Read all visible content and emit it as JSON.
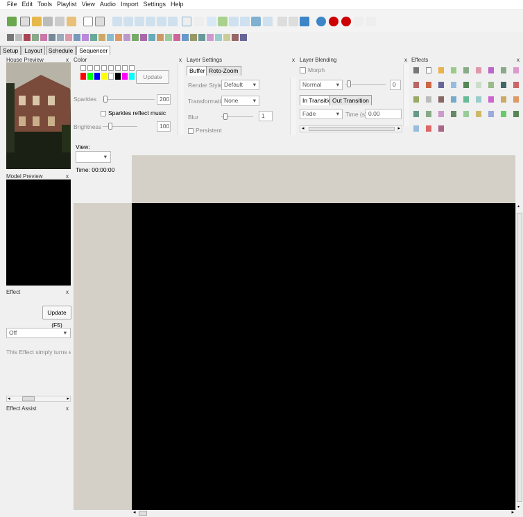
{
  "menu": [
    "File",
    "Edit",
    "Tools",
    "Playlist",
    "View",
    "Audio",
    "Import",
    "Settings",
    "Help"
  ],
  "tabs": [
    "Setup",
    "Layout",
    "Schedule",
    "Sequencer"
  ],
  "active_tab": "Sequencer",
  "panels": {
    "house_preview": {
      "title": "House Preview",
      "close": "x"
    },
    "model_preview": {
      "title": "Model Preview",
      "close": "x"
    },
    "effect": {
      "title": "Effect",
      "close": "x",
      "update_label": "Update (F5)",
      "selected": "Off",
      "description": "This Effect simply turns ever"
    },
    "effect_assist": {
      "title": "Effect Assist",
      "close": "x"
    },
    "color": {
      "title": "Color",
      "close": "x",
      "update_label": "Update",
      "sparkles_label": "Sparkles",
      "sparkles_value": "200",
      "sparkles_reflect_label": "Sparkles reflect music",
      "brightness_label": "Brightness",
      "brightness_value": "100"
    },
    "layer_settings": {
      "title": "Layer Settings",
      "close": "x",
      "tab_buffer": "Buffer",
      "tab_rotozoom": "Roto-Zoom",
      "render_style_label": "Render Style",
      "render_style_value": "Default",
      "transformation_label": "Transformation",
      "transformation_value": "None",
      "blur_label": "Blur",
      "blur_value": "1",
      "persistent_label": "Persistent"
    },
    "layer_blending": {
      "title": "Layer Blending",
      "close": "x",
      "morph_label": "Morph",
      "mode_value": "Normal",
      "mode_number": "0",
      "in_transition": "In Transition",
      "out_transition": "Out Transition",
      "transition_value": "Fade",
      "time_label": "Time (s)",
      "time_value": "0.00"
    },
    "effects": {
      "title": "Effects",
      "close": "x"
    }
  },
  "view": {
    "label": "View:",
    "time_label": "Time: 00:00:00"
  },
  "colors": {
    "swatches": [
      "#ffffff",
      "#ffffff",
      "#ffffff",
      "#ffffff",
      "#ffffff",
      "#ffffff",
      "#ffffff",
      "#ffffff"
    ],
    "palette": [
      "#ff0000",
      "#00ff00",
      "#0000ff",
      "#ffff00",
      "#ffffff",
      "#000000",
      "#ff00ff",
      "#00ffff"
    ]
  }
}
